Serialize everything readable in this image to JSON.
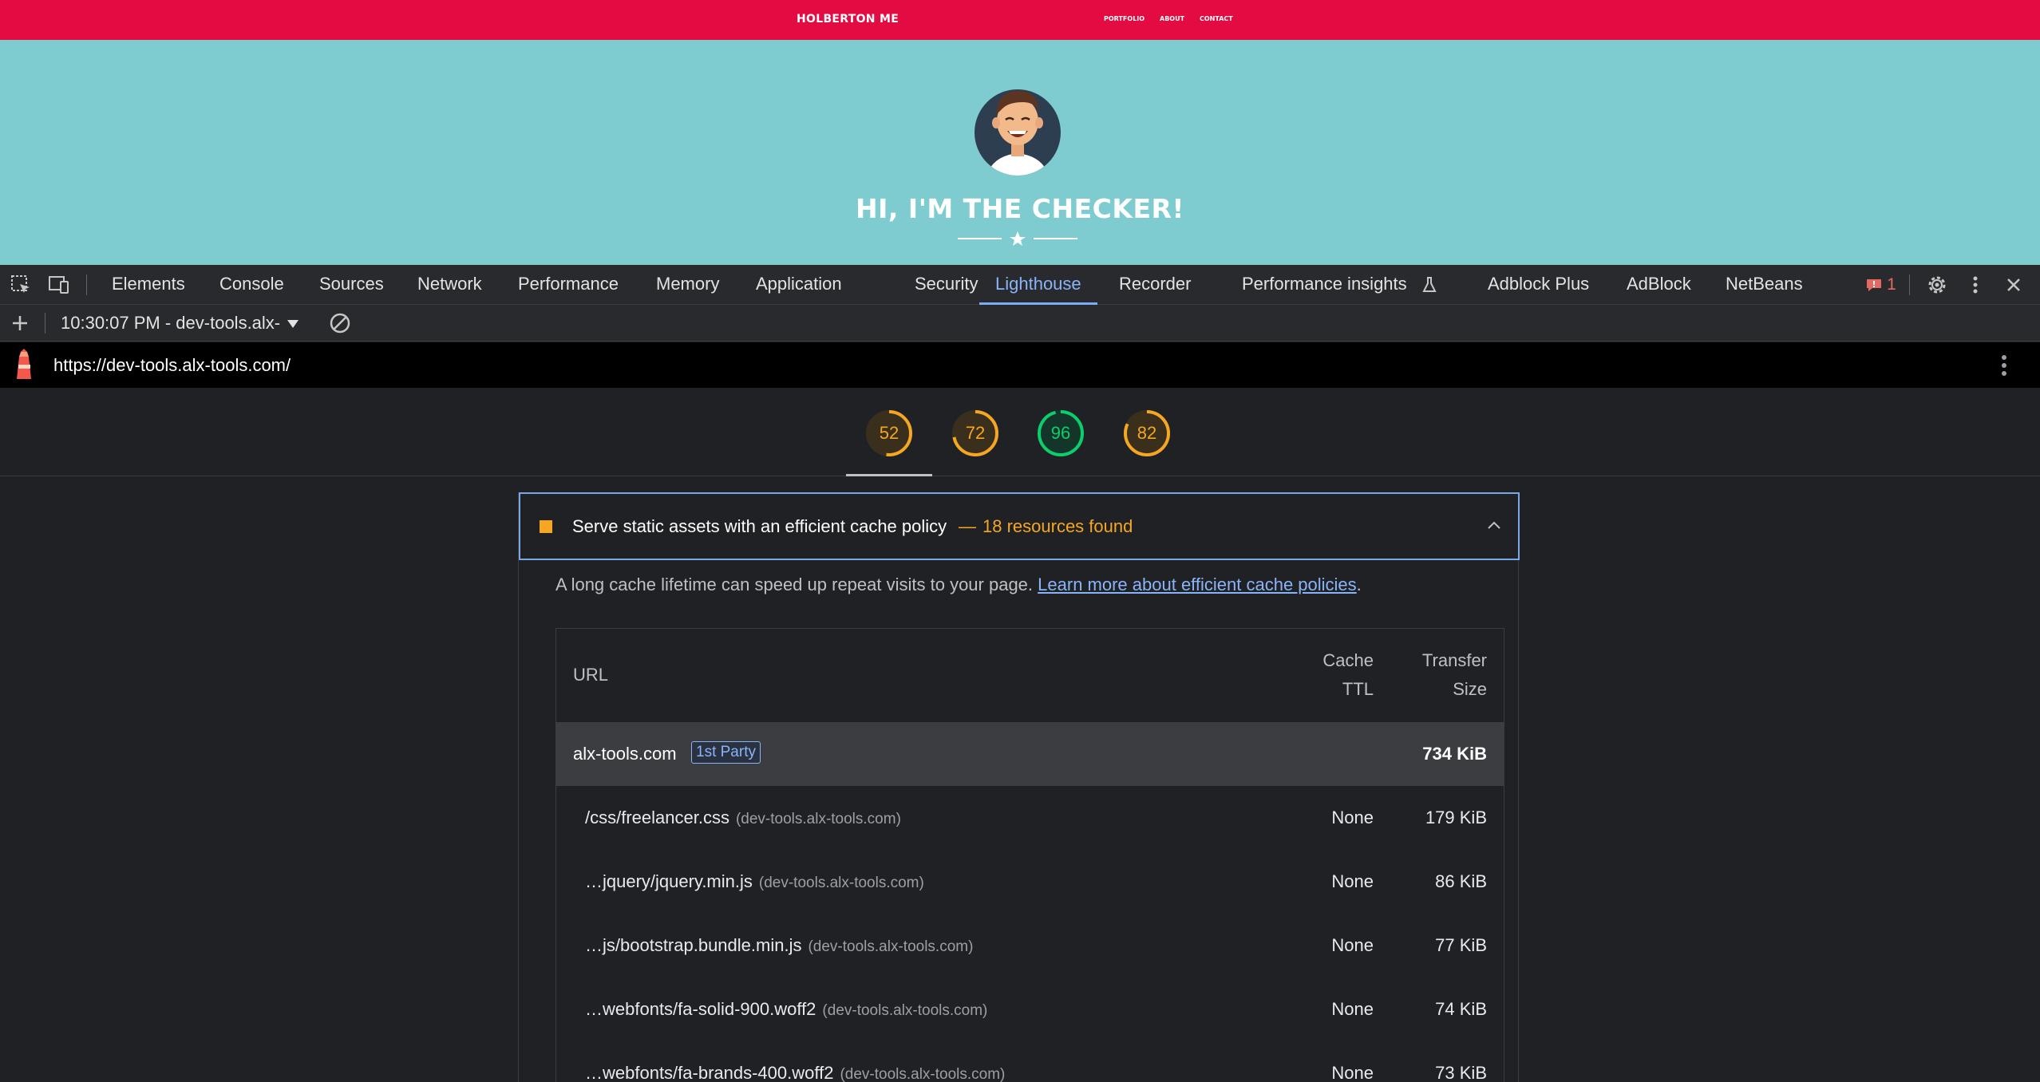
{
  "site": {
    "brand": "HOLBERTON ME",
    "nav_links": [
      "PORTFOLIO",
      "ABOUT",
      "CONTACT"
    ],
    "hero_title": "HI, I'M THE CHECKER!",
    "colors": {
      "nav": "#e20b42",
      "hero": "#7ecccf"
    }
  },
  "devtools": {
    "tabs": [
      "Elements",
      "Console",
      "Sources",
      "Network",
      "Performance",
      "Memory",
      "Application",
      "Security",
      "Lighthouse",
      "Recorder",
      "Performance insights",
      "Adblock Plus",
      "AdBlock",
      "NetBeans"
    ],
    "active_tab": "Lighthouse",
    "issues_count": "1",
    "icons": [
      "inspect-element-icon",
      "device-toolbar-icon",
      "flask-icon",
      "issues-icon",
      "settings-gear-icon",
      "more-vertical-icon",
      "close-icon"
    ]
  },
  "lighthouse": {
    "report_selector": "10:30:07 PM - dev-tools.alx-",
    "url": "https://dev-tools.alx-tools.com/",
    "scores": [
      {
        "value": "52",
        "fraction": 0.52,
        "color": "#f5a623"
      },
      {
        "value": "72",
        "fraction": 0.72,
        "color": "#f5a623"
      },
      {
        "value": "96",
        "fraction": 0.96,
        "color": "#0cce6b"
      },
      {
        "value": "82",
        "fraction": 0.82,
        "color": "#f5a623"
      }
    ],
    "audit": {
      "title": "Serve static assets with an efficient cache policy",
      "separator": "—",
      "display_value": "18 resources found",
      "description": "A long cache lifetime can speed up repeat visits to your page.",
      "link_text": "Learn more about efficient cache policies",
      "description_end": ".",
      "table": {
        "headers": {
          "url": "URL",
          "ttl_line1": "Cache",
          "ttl_line2": "TTL",
          "size_line1": "Transfer",
          "size_line2": "Size"
        },
        "group": {
          "name": "alx-tools.com",
          "badge": "1st Party",
          "size": "734 KiB"
        },
        "rows": [
          {
            "url": "/css/freelancer.css",
            "host": "(dev-tools.alx-tools.com)",
            "ttl": "None",
            "size": "179 KiB"
          },
          {
            "url": "…jquery/jquery.min.js",
            "host": "(dev-tools.alx-tools.com)",
            "ttl": "None",
            "size": "86 KiB"
          },
          {
            "url": "…js/bootstrap.bundle.min.js",
            "host": "(dev-tools.alx-tools.com)",
            "ttl": "None",
            "size": "77 KiB"
          },
          {
            "url": "…webfonts/fa-solid-900.woff2",
            "host": "(dev-tools.alx-tools.com)",
            "ttl": "None",
            "size": "74 KiB"
          },
          {
            "url": "…webfonts/fa-brands-400.woff2",
            "host": "(dev-tools.alx-tools.com)",
            "ttl": "None",
            "size": "73 KiB"
          }
        ]
      }
    }
  }
}
